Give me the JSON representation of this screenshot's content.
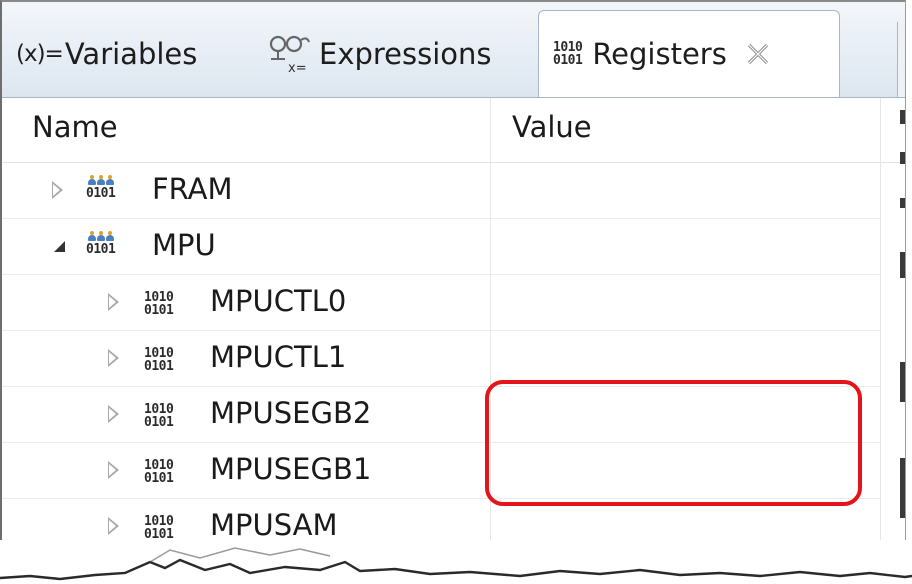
{
  "tabs": {
    "variables": {
      "icon": "(x)=",
      "label": "Variables"
    },
    "expressions": {
      "label": "Expressions"
    },
    "registers": {
      "label": "Registers",
      "icon_top": "1010",
      "icon_bottom": "0101"
    }
  },
  "columns": {
    "name": "Name",
    "value": "Value"
  },
  "rows": [
    {
      "label": "FRAM",
      "level": 0,
      "expanded": false,
      "icon": "register-group-icon",
      "value": ""
    },
    {
      "label": "MPU",
      "level": 0,
      "expanded": true,
      "icon": "register-group-icon",
      "value": ""
    },
    {
      "label": "MPUCTL0",
      "level": 1,
      "expanded": false,
      "icon": "register-icon",
      "value": ""
    },
    {
      "label": "MPUCTL1",
      "level": 1,
      "expanded": false,
      "icon": "register-icon",
      "value": ""
    },
    {
      "label": "MPUSEGB2",
      "level": 1,
      "expanded": false,
      "icon": "register-icon",
      "value": ""
    },
    {
      "label": "MPUSEGB1",
      "level": 1,
      "expanded": false,
      "icon": "register-icon",
      "value": ""
    },
    {
      "label": "MPUSAM",
      "level": 1,
      "expanded": false,
      "icon": "register-icon",
      "value": ""
    }
  ],
  "bits": {
    "top": "1010",
    "bottom": "0101",
    "group_bottom": "0101"
  },
  "colors": {
    "highlight": "#e3151a",
    "tab_bg": "#dde6f0",
    "person_head": "#e0a020",
    "person_body": "#4a7fc1"
  }
}
